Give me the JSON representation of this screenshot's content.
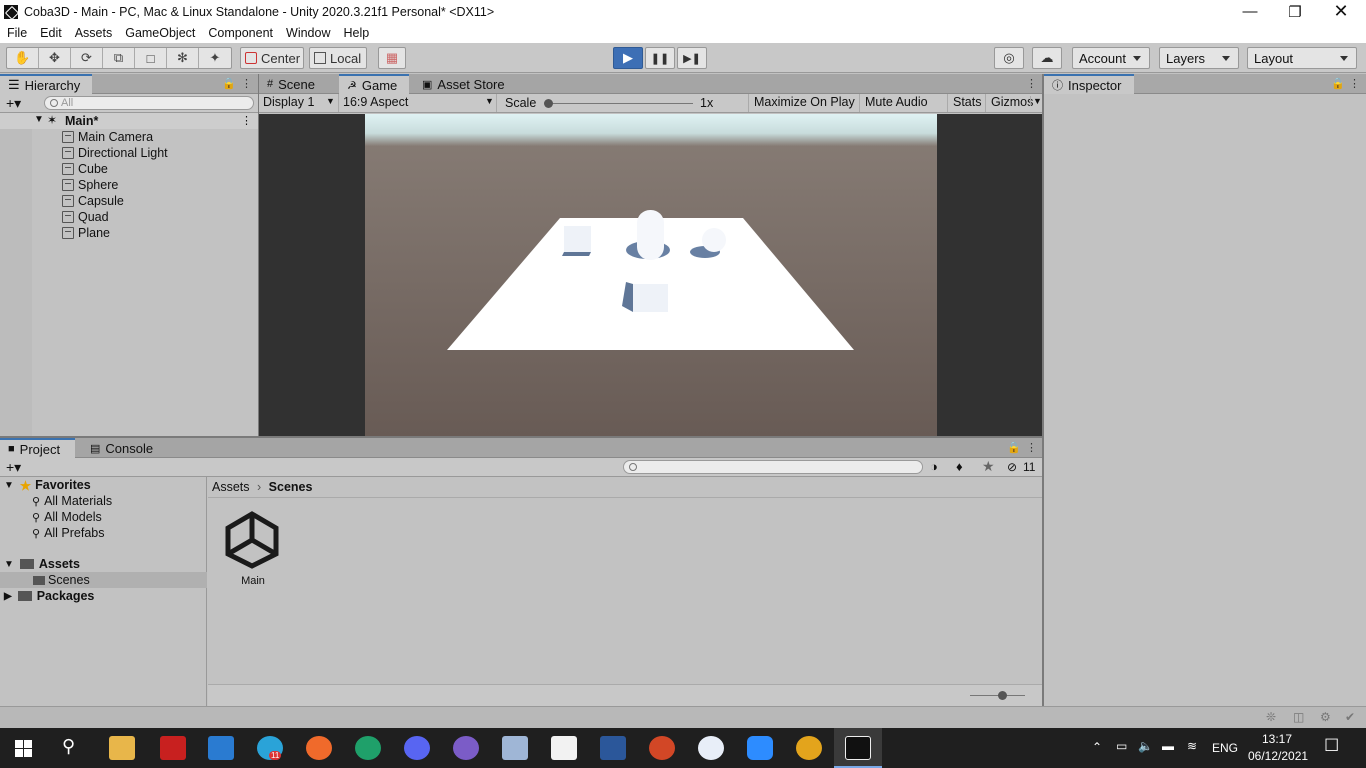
{
  "window": {
    "title": "Coba3D - Main - PC, Mac & Linux Standalone - Unity 2020.3.21f1 Personal* <DX11>"
  },
  "menu": [
    "File",
    "Edit",
    "Assets",
    "GameObject",
    "Component",
    "Window",
    "Help"
  ],
  "toolbar": {
    "center_label": "Center",
    "local_label": "Local",
    "account_label": "Account",
    "layers_label": "Layers",
    "layout_label": "Layout"
  },
  "hierarchy": {
    "tab": "Hierarchy",
    "search_placeholder": "All",
    "scene": "Main*",
    "items": [
      "Main Camera",
      "Directional Light",
      "Cube",
      "Sphere",
      "Capsule",
      "Quad",
      "Plane"
    ]
  },
  "center_tabs": [
    "Scene",
    "Game",
    "Asset Store"
  ],
  "game_bar": {
    "display": "Display 1",
    "aspect": "16:9 Aspect",
    "scale_label": "Scale",
    "scale_value": "1x",
    "maximize": "Maximize On Play",
    "mute": "Mute Audio",
    "stats": "Stats",
    "gizmos": "Gizmos"
  },
  "inspector": {
    "tab": "Inspector"
  },
  "project": {
    "tabs": [
      "Project",
      "Console"
    ],
    "hidden_count": "11",
    "favorites_label": "Favorites",
    "favorites": [
      "All Materials",
      "All Models",
      "All Prefabs"
    ],
    "assets_label": "Assets",
    "scenes_label": "Scenes",
    "packages_label": "Packages",
    "breadcrumb": [
      "Assets",
      "Scenes"
    ],
    "files": [
      "Main"
    ]
  },
  "taskbar": {
    "lang": "ENG",
    "time": "13:17",
    "date": "06/12/2021",
    "telegram_badge": "11"
  },
  "colors": {
    "accent": "#3a72b0",
    "play_active": "#3d6fb5",
    "taskbar": "#1f1f1f"
  }
}
